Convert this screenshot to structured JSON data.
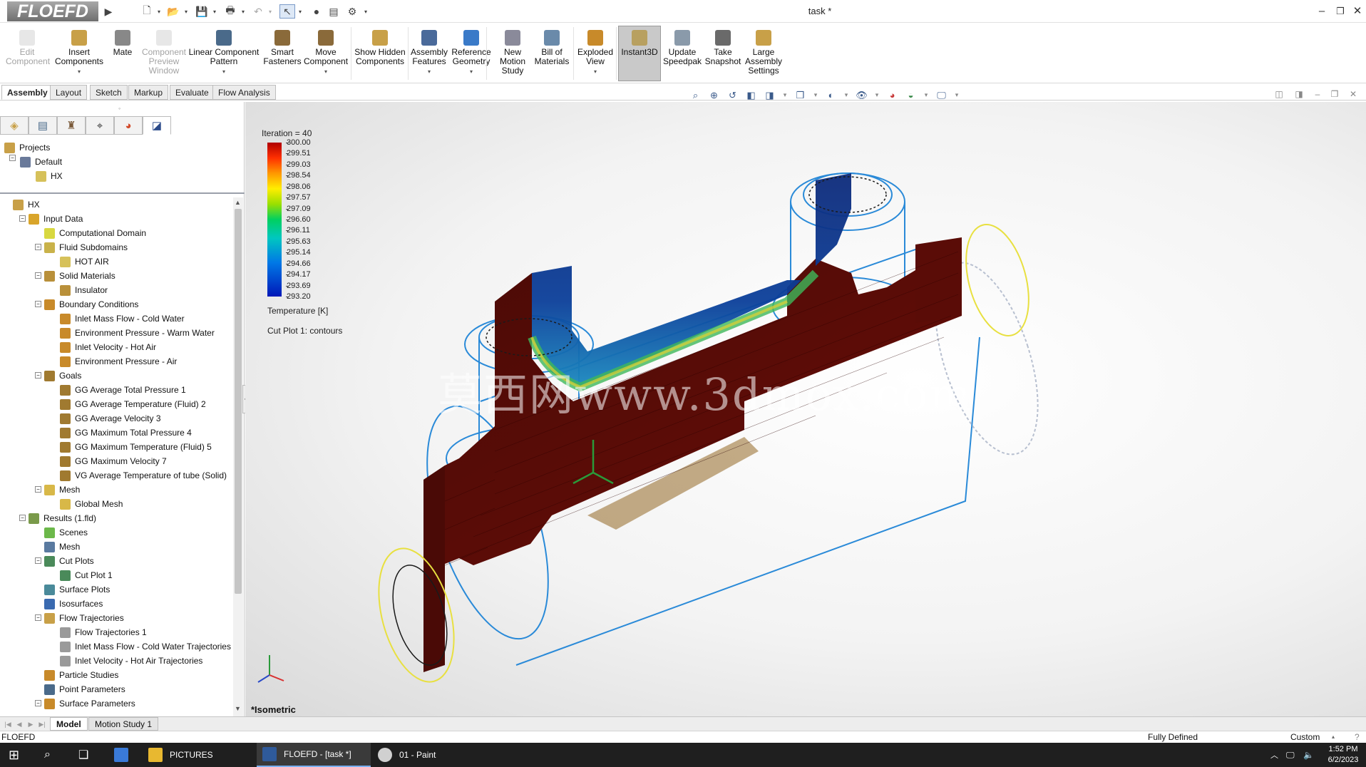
{
  "app": {
    "logo": "FLOEFD",
    "window_title": "task *"
  },
  "ribbon": [
    {
      "label": "Edit Component",
      "disabled": true
    },
    {
      "label": "Insert Components",
      "disabled": false,
      "dropdown": true
    },
    {
      "label": "Mate",
      "disabled": false
    },
    {
      "label": "Component Preview Window",
      "disabled": true
    },
    {
      "label": "Linear Component Pattern",
      "disabled": false,
      "dropdown": true
    },
    {
      "label": "Smart Fasteners",
      "disabled": false
    },
    {
      "label": "Move Component",
      "disabled": false,
      "dropdown": true
    },
    {
      "label": "Show Hidden Components",
      "disabled": false
    },
    {
      "label": "Assembly Features",
      "disabled": false,
      "dropdown": true
    },
    {
      "label": "Reference Geometry",
      "disabled": false,
      "dropdown": true
    },
    {
      "label": "New Motion Study",
      "disabled": false
    },
    {
      "label": "Bill of Materials",
      "disabled": false
    },
    {
      "label": "Exploded View",
      "disabled": false,
      "dropdown": true
    },
    {
      "label": "Instant3D",
      "disabled": false,
      "active": true
    },
    {
      "label": "Update Speedpak",
      "disabled": false
    },
    {
      "label": "Take Snapshot",
      "disabled": false
    },
    {
      "label": "Large Assembly Settings",
      "disabled": false
    }
  ],
  "command_tabs": [
    "Assembly",
    "Layout",
    "Sketch",
    "Markup",
    "Evaluate",
    "Flow Analysis"
  ],
  "project_tree": {
    "root": "Projects",
    "config": "Default",
    "item": "HX"
  },
  "analysis_tree": [
    {
      "label": "HX",
      "level": 0,
      "toggle": "",
      "icon": "#c8a048"
    },
    {
      "label": "Input Data",
      "level": 1,
      "toggle": "−",
      "icon": "#d9a52a"
    },
    {
      "label": "Computational Domain",
      "level": 2,
      "toggle": "",
      "icon": "#d8d840"
    },
    {
      "label": "Fluid Subdomains",
      "level": 2,
      "toggle": "−",
      "icon": "#c9b24a"
    },
    {
      "label": "HOT AIR",
      "level": 3,
      "toggle": "",
      "icon": "#d6c15a"
    },
    {
      "label": "Solid Materials",
      "level": 2,
      "toggle": "−",
      "icon": "#b9903a"
    },
    {
      "label": "Insulator",
      "level": 3,
      "toggle": "",
      "icon": "#b9903a"
    },
    {
      "label": "Boundary Conditions",
      "level": 2,
      "toggle": "−",
      "icon": "#c88a2a"
    },
    {
      "label": "Inlet Mass Flow - Cold Water",
      "level": 3,
      "toggle": "",
      "icon": "#c88a2a"
    },
    {
      "label": "Environment Pressure - Warm Water",
      "level": 3,
      "toggle": "",
      "icon": "#c88a2a"
    },
    {
      "label": "Inlet Velocity - Hot Air",
      "level": 3,
      "toggle": "",
      "icon": "#c88a2a"
    },
    {
      "label": "Environment Pressure - Air",
      "level": 3,
      "toggle": "",
      "icon": "#c88a2a"
    },
    {
      "label": "Goals",
      "level": 2,
      "toggle": "−",
      "icon": "#a07a30"
    },
    {
      "label": "GG Average Total Pressure 1",
      "level": 3,
      "toggle": "",
      "icon": "#a07a30"
    },
    {
      "label": "GG Average Temperature (Fluid) 2",
      "level": 3,
      "toggle": "",
      "icon": "#a07a30"
    },
    {
      "label": "GG Average Velocity 3",
      "level": 3,
      "toggle": "",
      "icon": "#a07a30"
    },
    {
      "label": "GG Maximum Total Pressure 4",
      "level": 3,
      "toggle": "",
      "icon": "#a07a30"
    },
    {
      "label": "GG Maximum Temperature (Fluid) 5",
      "level": 3,
      "toggle": "",
      "icon": "#a07a30"
    },
    {
      "label": "GG Maximum Velocity 7",
      "level": 3,
      "toggle": "",
      "icon": "#a07a30"
    },
    {
      "label": "VG Average Temperature of tube (Solid)",
      "level": 3,
      "toggle": "",
      "icon": "#a07a30"
    },
    {
      "label": "Mesh",
      "level": 2,
      "toggle": "−",
      "icon": "#d8b848"
    },
    {
      "label": "Global Mesh",
      "level": 3,
      "toggle": "",
      "icon": "#d8b848"
    },
    {
      "label": "Results (1.fld)",
      "level": 1,
      "toggle": "−",
      "icon": "#7a9a4a"
    },
    {
      "label": "Scenes",
      "level": 2,
      "toggle": "",
      "icon": "#6cb84a"
    },
    {
      "label": "Mesh",
      "level": 2,
      "toggle": "",
      "icon": "#5a7aa0"
    },
    {
      "label": "Cut Plots",
      "level": 2,
      "toggle": "−",
      "icon": "#4a8a5a"
    },
    {
      "label": "Cut Plot 1",
      "level": 3,
      "toggle": "",
      "icon": "#4a8a5a"
    },
    {
      "label": "Surface Plots",
      "level": 2,
      "toggle": "",
      "icon": "#4a8a9a"
    },
    {
      "label": "Isosurfaces",
      "level": 2,
      "toggle": "",
      "icon": "#3a6ab0"
    },
    {
      "label": "Flow Trajectories",
      "level": 2,
      "toggle": "−",
      "icon": "#c8a048"
    },
    {
      "label": "Flow Trajectories 1",
      "level": 3,
      "toggle": "",
      "icon": "#9a9a9a"
    },
    {
      "label": "Inlet Mass Flow - Cold Water Trajectories",
      "level": 3,
      "toggle": "",
      "icon": "#9a9a9a"
    },
    {
      "label": "Inlet Velocity - Hot Air Trajectories",
      "level": 3,
      "toggle": "",
      "icon": "#9a9a9a"
    },
    {
      "label": "Particle Studies",
      "level": 2,
      "toggle": "",
      "icon": "#c88a2a"
    },
    {
      "label": "Point Parameters",
      "level": 2,
      "toggle": "",
      "icon": "#4a6a8a"
    },
    {
      "label": "Surface Parameters",
      "level": 2,
      "toggle": "−",
      "icon": "#c88a2a"
    }
  ],
  "viewport": {
    "iteration": "Iteration = 40",
    "legend_values": [
      "300.00",
      "299.51",
      "299.03",
      "298.54",
      "298.06",
      "297.57",
      "297.09",
      "296.60",
      "296.11",
      "295.63",
      "295.14",
      "294.66",
      "294.17",
      "293.69",
      "293.20"
    ],
    "legend_unit": "Temperature [K]",
    "cut_plot_label": "Cut Plot 1: contours",
    "view_name": "*Isometric",
    "watermark": "莫西网www.3dmox.com"
  },
  "bottom_tabs": [
    "Model",
    "Motion Study 1"
  ],
  "status": {
    "left": "FLOEFD",
    "state": "Fully Defined",
    "units": "Custom"
  },
  "taskbar": {
    "items": [
      "PICTURES",
      "FLOEFD - [task *]",
      "01 - Paint"
    ],
    "time": "1:52 PM",
    "date": "6/2/2023"
  },
  "colors": {
    "accent": "#2f6db4",
    "active_tool": "#c9c9c9",
    "taskbar": "#1f1f1f"
  }
}
